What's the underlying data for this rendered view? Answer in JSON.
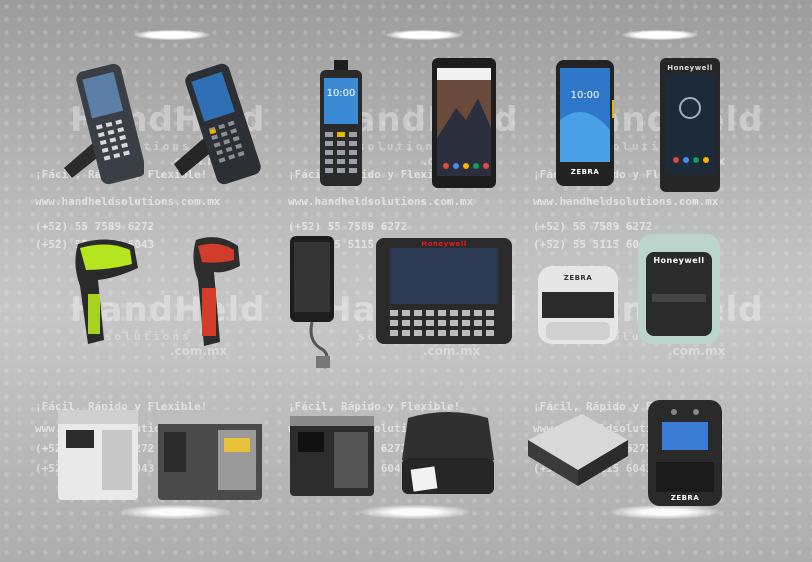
{
  "watermark": {
    "brand": "HandHeld",
    "sub": "solutions",
    "domain": ".com.mx",
    "slogan": "¡Fácil, Rápido y Flexible!",
    "website": "www.handheldsolutions.com.mx",
    "phone1": "(+52) 55 7589 6272",
    "phone2": "(+52) 55 5115 6043"
  },
  "products": {
    "phone_clock": "10:00",
    "honeywell_brand": "Honeywell",
    "zebra_brand": "ZEBRA"
  },
  "colors": {
    "accent_green": "#b5e61d",
    "accent_red": "#d23c2b",
    "device_dark": "#222222",
    "honeywell_red": "#e31b23"
  }
}
